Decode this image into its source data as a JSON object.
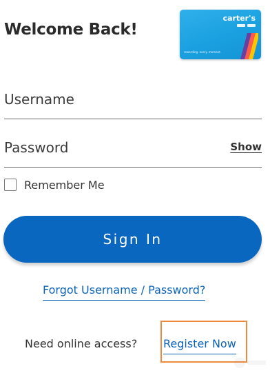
{
  "header": {
    "title": "Welcome Back!"
  },
  "card": {
    "brand": "carter's",
    "tagline": "rewarding. every. moment.",
    "color": "#1aa0e0"
  },
  "form": {
    "username_label": "Username",
    "password_label": "Password",
    "show_label": "Show",
    "remember_label": "Remember Me",
    "remember_checked": false,
    "signin_label": "Sign In",
    "forgot_label": "Forgot Username / Password?"
  },
  "footer": {
    "need_access_text": "Need online access?",
    "register_label": "Register Now"
  },
  "colors": {
    "primary": "#0a67c0",
    "link": "#0b63b8",
    "highlight": "#f08a3c"
  },
  "icons": {
    "checkbox": "checkbox-unchecked-icon"
  }
}
